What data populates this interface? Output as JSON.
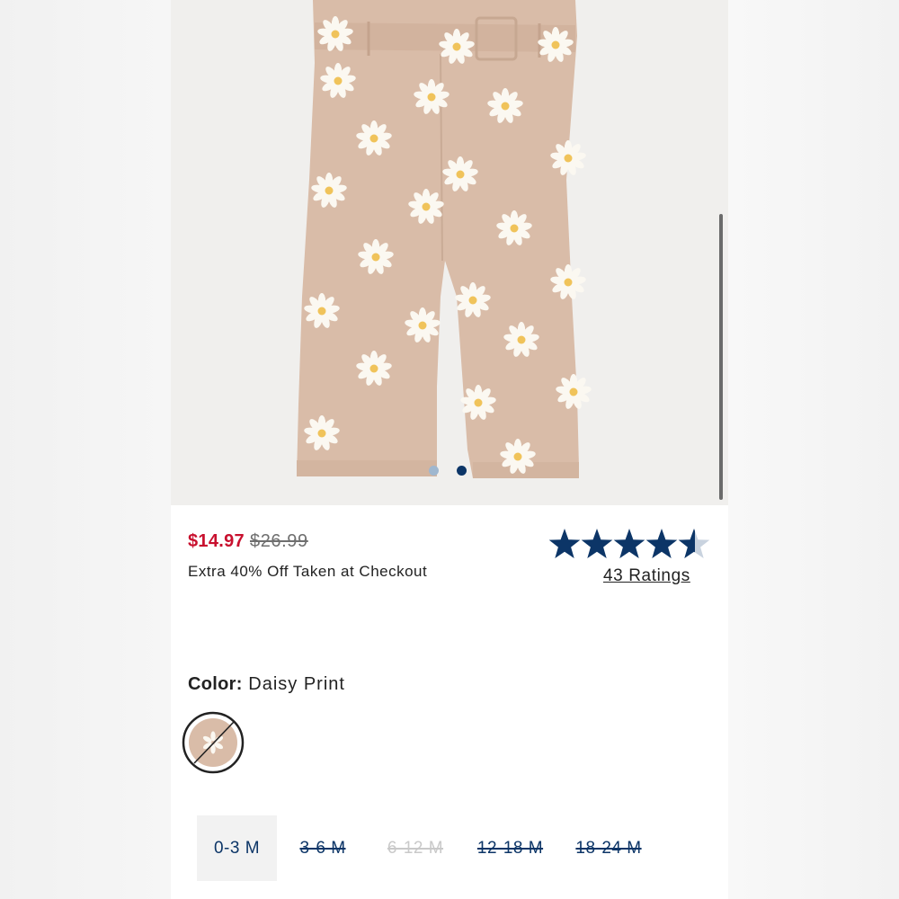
{
  "product": {
    "image_alt": "Daisy print jumpsuit",
    "carousel_dot_count": 2,
    "carousel_active_index": 1
  },
  "pricing": {
    "sale_price": "$14.97",
    "original_price": "$26.99",
    "promo_text": "Extra 40% Off Taken at Checkout",
    "sale_color": "#c8102e"
  },
  "rating": {
    "stars": 4.5,
    "ratings_label": "43 Ratings",
    "star_color": "#0c3567"
  },
  "color": {
    "label": "Color:",
    "value": "Daisy Print"
  },
  "sizes": [
    {
      "label": "0-3 M",
      "state": "selected"
    },
    {
      "label": "3-6 M",
      "state": "unavailable"
    },
    {
      "label": "6-12 M",
      "state": "disabled"
    },
    {
      "label": "12-18 M",
      "state": "unavailable"
    },
    {
      "label": "18-24 M",
      "state": "unavailable"
    }
  ]
}
